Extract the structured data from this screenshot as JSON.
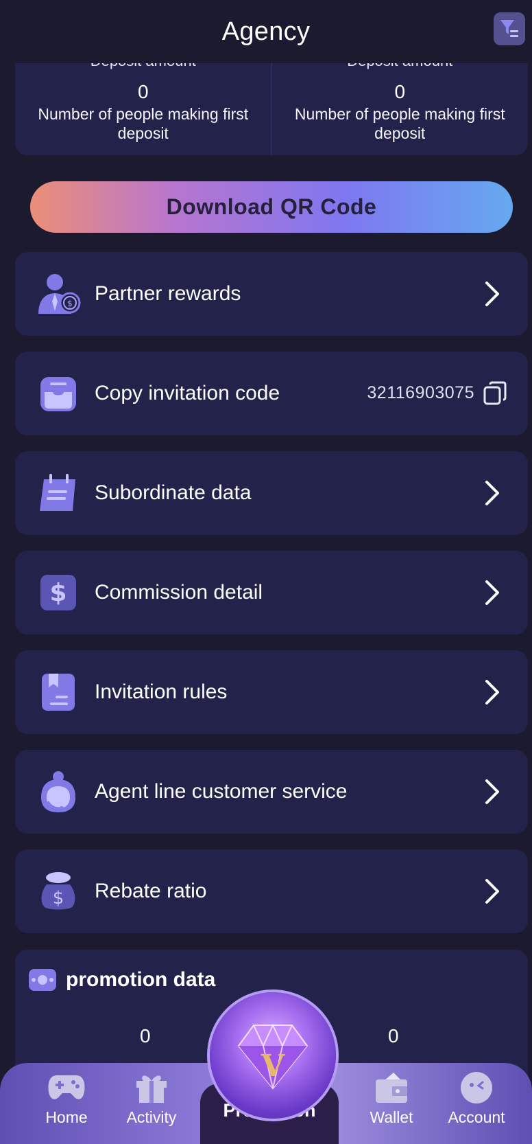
{
  "header": {
    "title": "Agency"
  },
  "stats": {
    "cut_label": "Deposit amount",
    "columns": [
      {
        "value": "0",
        "label": "Number of people making first deposit"
      },
      {
        "value": "0",
        "label": "Number of people making first deposit"
      }
    ]
  },
  "qr_button": {
    "label": "Download QR Code"
  },
  "menu": {
    "partner_rewards": "Partner rewards",
    "copy_invitation_code": "Copy invitation code",
    "invitation_code_value": "32116903075",
    "subordinate_data": "Subordinate data",
    "commission_detail": "Commission detail",
    "invitation_rules": "Invitation rules",
    "agent_line_customer_service": "Agent line customer service",
    "rebate_ratio": "Rebate ratio"
  },
  "promotion_data": {
    "title": "promotion data",
    "left_value": "0",
    "right_value": "0"
  },
  "navbar": {
    "home": "Home",
    "activity": "Activity",
    "promotion": "Promotion",
    "wallet": "Wallet",
    "account": "Account"
  },
  "colors": {
    "background": "#1b1a2e",
    "card": "#22224a",
    "accent_icon": "#8079e6",
    "navbar": "#7c6bd1"
  },
  "icons": [
    "filter-icon",
    "partner-icon",
    "inbox-icon",
    "calendar-icon",
    "dollar-icon",
    "bookmark-icon",
    "headset-icon",
    "money-bag-icon",
    "chevron-right-icon",
    "copy-icon",
    "promotion-data-icon",
    "gamepad-icon",
    "gift-icon",
    "diamond-icon",
    "wallet-icon",
    "account-icon"
  ]
}
